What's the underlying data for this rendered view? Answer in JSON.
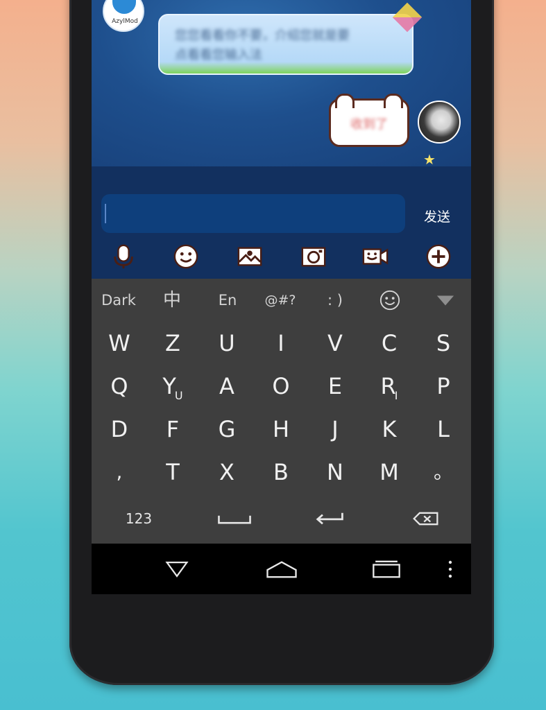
{
  "chat": {
    "left_avatar_label": "AzylMod",
    "left_message": "您您看看你不要，介绍您就是要\n点看看您输入法",
    "right_message": "收到了"
  },
  "composer": {
    "input_value": "",
    "send_label": "发送",
    "tools": [
      "microphone-icon",
      "emoji-icon",
      "image-icon",
      "camera-icon",
      "video-icon",
      "plus-icon"
    ]
  },
  "keyboard": {
    "theme_label": "Dark",
    "topbar": [
      "Dark",
      "中",
      "En",
      "@#?",
      ": )"
    ],
    "rows": [
      [
        "W",
        "Z",
        "U",
        "I",
        "V",
        "C",
        "S"
      ],
      [
        "Q",
        "Y",
        "A",
        "O",
        "E",
        "R",
        "P"
      ],
      [
        "D",
        "F",
        "G",
        "H",
        "J",
        "K",
        "L"
      ],
      [
        ",",
        "T",
        "X",
        "B",
        "N",
        "M",
        "。"
      ]
    ],
    "row2_subs": {
      "Y": "U",
      "R": "I"
    },
    "numbers_label": "123",
    "accent_color": "#3e3e3e",
    "key_text_color": "#f1f1f1"
  },
  "navbar": {
    "icons": [
      "back-icon",
      "home-icon",
      "recents-icon",
      "menu-icon"
    ]
  }
}
